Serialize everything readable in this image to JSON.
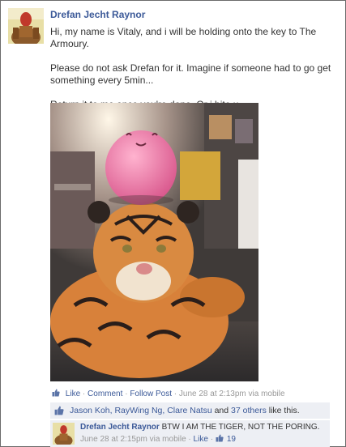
{
  "post": {
    "author": "Drefan Jecht Raynor",
    "paragraph1": "Hi, my name is Vitaly, and i will be holding onto the key to The Armoury.",
    "paragraph2": "Please do not ask Drefan for it. Imagine if someone had to go get something every 5min...",
    "paragraph3": "Return it to me once you're done. Or i bite u."
  },
  "actions": {
    "like": "Like",
    "sep": "·",
    "comment": "Comment",
    "follow": "Follow Post",
    "timestamp": "June 28 at 2:13pm via mobile"
  },
  "likes": {
    "names": "Jason Koh, RayWing Ng, Clare Natsu",
    "and_word": "and",
    "others_link": "37 others",
    "suffix": "like this."
  },
  "comment": {
    "author": "Drefan Jecht Raynor",
    "text": "BTW I AM THE TIGER, NOT THE PORING.",
    "timestamp": "June 28 at 2:15pm via mobile",
    "sep": "·",
    "like_link": "Like",
    "like_count": "19"
  },
  "colors": {
    "link": "#3b5998",
    "meta_text": "#999999",
    "likes_bg": "#edeff4",
    "border": "#6b6b6b"
  },
  "icons": [
    "like-thumb-icon",
    "thumbs-up-icon"
  ]
}
